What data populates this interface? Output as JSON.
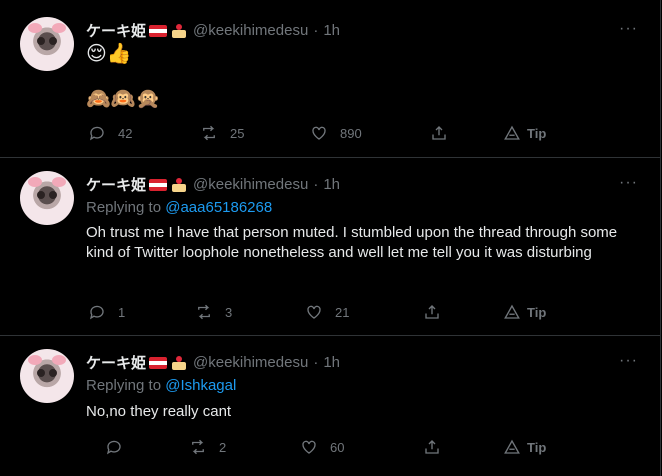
{
  "tweets": [
    {
      "author_name": "ケーキ姫",
      "handle": "@keekihimedesu",
      "separator": "·",
      "time": "1h",
      "more": "···",
      "line1": "😌👍",
      "line2": "🙈🙉🙊",
      "stats": {
        "replies": "42",
        "retweets": "25",
        "likes": "890",
        "tip": "Tip"
      }
    },
    {
      "author_name": "ケーキ姫",
      "handle": "@keekihimedesu",
      "separator": "·",
      "time": "1h",
      "more": "···",
      "replying_label": "Replying to",
      "replying_to": "@aaa65186268",
      "text": "Oh trust me I have that person muted. I stumbled upon the thread through some kind of Twitter loophole nonetheless and well let me tell you it was disturbing",
      "stats": {
        "replies": "1",
        "retweets": "3",
        "likes": "21",
        "tip": "Tip"
      }
    },
    {
      "author_name": "ケーキ姫",
      "handle": "@keekihimedesu",
      "separator": "·",
      "time": "1h",
      "more": "···",
      "replying_label": "Replying to",
      "replying_to": "@Ishkagal",
      "text": "No,no they really cant",
      "stats": {
        "replies": "",
        "retweets": "2",
        "likes": "60",
        "tip": "Tip"
      }
    }
  ],
  "colors": {
    "background": "#000000",
    "text": "#e7e9ea",
    "muted": "#71767b",
    "link": "#1d9bf0",
    "border": "#2f3336"
  }
}
